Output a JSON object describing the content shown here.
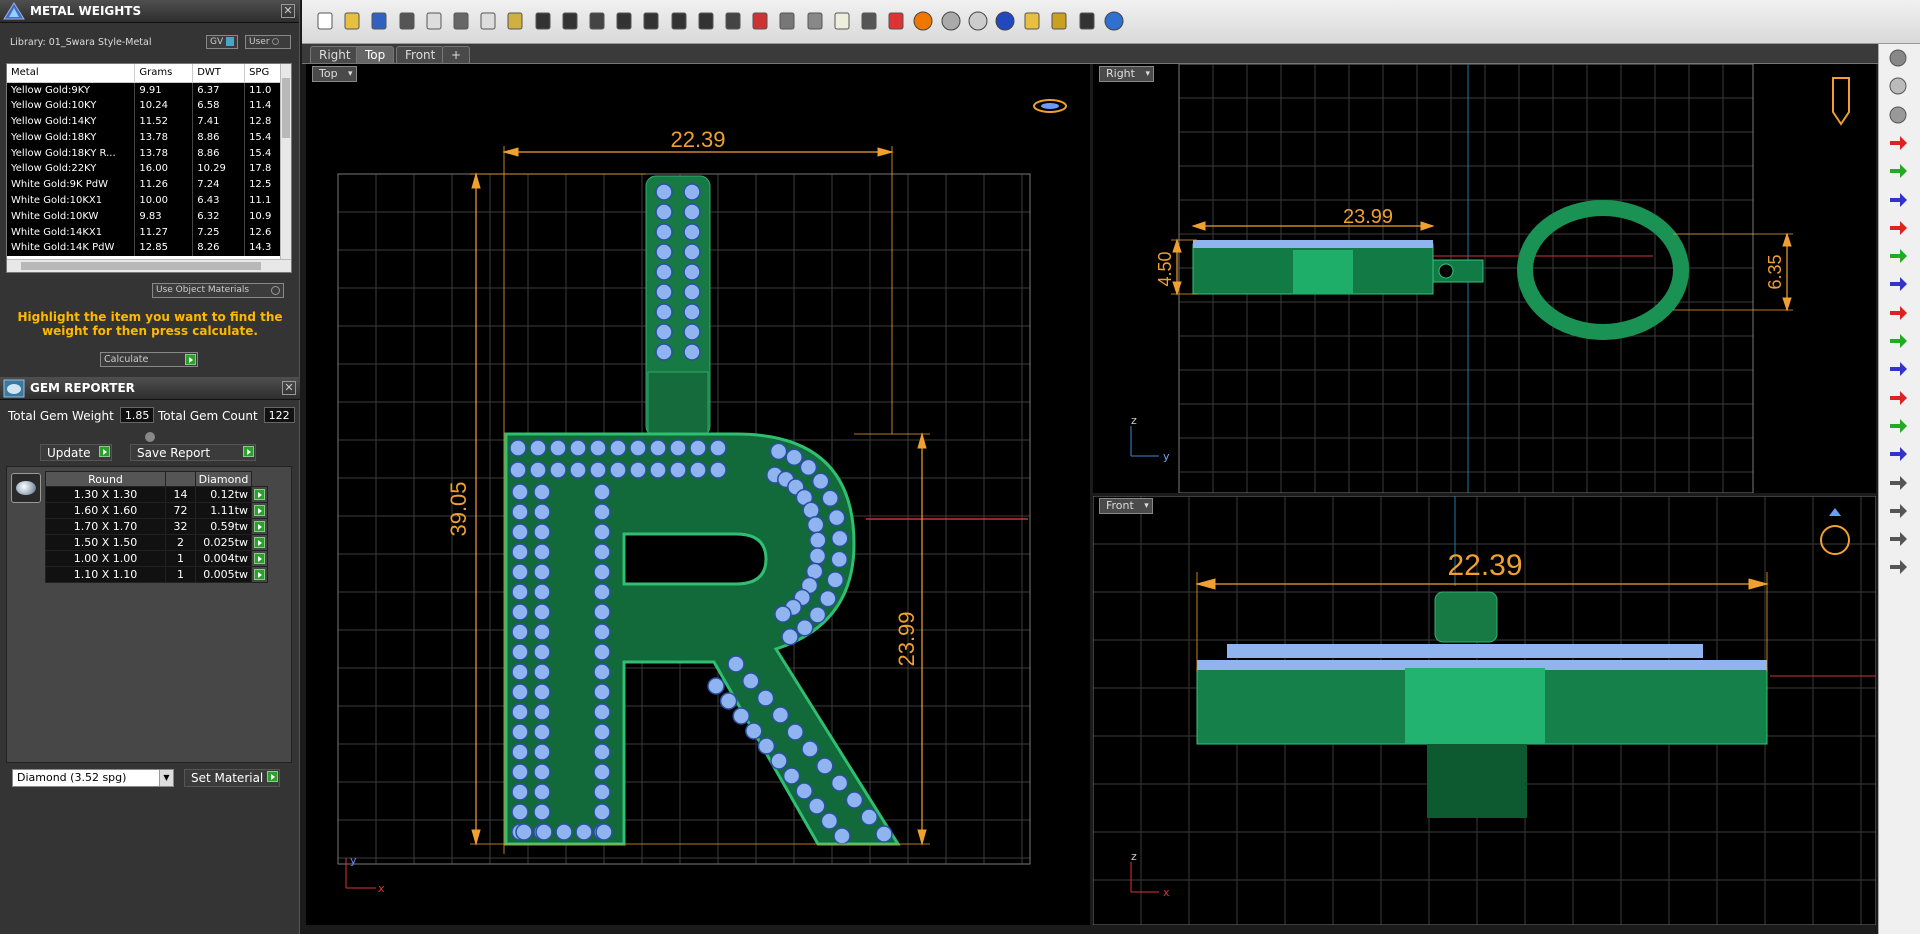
{
  "metal_weights": {
    "title": "METAL WEIGHTS",
    "library_label": "Library: 01_Swara Style-Metal",
    "gv_label": "GV",
    "user_label": "User",
    "columns": [
      "Metal",
      "Grams",
      "DWT",
      "SPG"
    ],
    "rows": [
      [
        "Yellow Gold:9KY",
        "9.91",
        "6.37",
        "11.0"
      ],
      [
        "Yellow Gold:10KY",
        "10.24",
        "6.58",
        "11.4"
      ],
      [
        "Yellow Gold:14KY",
        "11.52",
        "7.41",
        "12.8"
      ],
      [
        "Yellow Gold:18KY",
        "13.78",
        "8.86",
        "15.4"
      ],
      [
        "Yellow Gold:18KY R...",
        "13.78",
        "8.86",
        "15.4"
      ],
      [
        "Yellow Gold:22KY",
        "16.00",
        "10.29",
        "17.8"
      ],
      [
        "White Gold:9K PdW",
        "11.26",
        "7.24",
        "12.5"
      ],
      [
        "White Gold:10KX1",
        "10.00",
        "6.43",
        "11.1"
      ],
      [
        "White Gold:10KW",
        "9.83",
        "6.32",
        "10.9"
      ],
      [
        "White Gold:14KX1",
        "11.27",
        "7.25",
        "12.6"
      ],
      [
        "White Gold:14K PdW",
        "12.85",
        "8.26",
        "14.3"
      ]
    ],
    "use_object_materials": "Use Object Materials",
    "instruction": "Highlight the item you want to find the weight for then press calculate.",
    "calculate_label": "Calculate"
  },
  "gem_reporter": {
    "title": "GEM REPORTER",
    "total_weight_label": "Total Gem Weight",
    "total_weight_value": "1.85",
    "total_count_label": "Total Gem Count",
    "total_count_value": "122",
    "update_label": "Update",
    "save_report_label": "Save Report",
    "columns": [
      "Round",
      "",
      "Diamond"
    ],
    "rows": [
      [
        "1.30 X 1.30",
        "14",
        "0.12tw"
      ],
      [
        "1.60 X 1.60",
        "72",
        "1.11tw"
      ],
      [
        "1.70 X 1.70",
        "32",
        "0.59tw"
      ],
      [
        "1.50 X 1.50",
        "2",
        "0.025tw"
      ],
      [
        "1.00 X 1.00",
        "1",
        "0.004tw"
      ],
      [
        "1.10 X 1.10",
        "1",
        "0.005tw"
      ]
    ],
    "material_value": "Diamond     (3.52 spg)",
    "set_material_label": "Set Material"
  },
  "tabs": [
    "Right",
    "Top",
    "Front",
    "+"
  ],
  "viewports": {
    "top": {
      "label": "Top",
      "dim_width": "22.39",
      "dim_height": "39.05",
      "dim_letter": "23.99",
      "axis_y": "y",
      "axis_x": "x"
    },
    "right": {
      "label": "Right",
      "dim_length": "23.99",
      "dim_thickness": "4.50",
      "dim_bail": "6.35",
      "axis_z": "z",
      "axis_y": "y"
    },
    "front": {
      "label": "Front",
      "dim_width": "22.39",
      "axis_z": "z",
      "axis_x": "x"
    }
  },
  "icons": {
    "toolbar": [
      "new-icon",
      "open-icon",
      "save-icon",
      "print-icon",
      "copy-doc-icon",
      "cut-icon",
      "copy-icon",
      "paste-icon",
      "undo-icon",
      "pan-icon",
      "move-icon",
      "zoom-icon",
      "zoom-window-icon",
      "zoom-extents-icon",
      "zoom-selected-icon",
      "grid-icon",
      "car-icon",
      "snap-icon",
      "rotate-icon",
      "lamp-icon",
      "lock-icon",
      "layer-icon",
      "color-icon",
      "sphere-shaded-icon",
      "sphere-wire-icon",
      "globe-icon",
      "pen-icon",
      "gear-icon",
      "settings-icon",
      "help-icon"
    ]
  },
  "colors": {
    "dimension": "#f0a030",
    "metal": "#1d8a52",
    "gem": "#8fb4f0",
    "grid": "#3a3a3a",
    "highlight": "#ffb800"
  }
}
